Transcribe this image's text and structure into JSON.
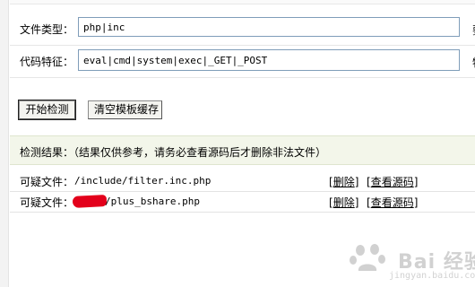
{
  "form": {
    "file_type": {
      "label": "文件类型：",
      "value": "php|inc",
      "trailing": "要"
    },
    "code_signature": {
      "label": "代码特征：",
      "value": "eval|cmd|system|exec|_GET|_POST",
      "trailing": "特"
    }
  },
  "actions": {
    "start_label": "开始检测",
    "clear_label": "清空模板缓存"
  },
  "results": {
    "header": "检测结果：（结果仅供参考，请务必查看源码后才删除非法文件）",
    "rows": [
      {
        "label": "可疑文件：",
        "path": "/include/filter.inc.php",
        "delete": "删除",
        "view": "查看源码"
      },
      {
        "label": "可疑文件：",
        "path": "/plus_bshare.php",
        "delete": "删除",
        "view": "查看源码"
      }
    ]
  },
  "watermark": {
    "brand": "Bai 经验",
    "url": "jingyan.baidu.com"
  }
}
